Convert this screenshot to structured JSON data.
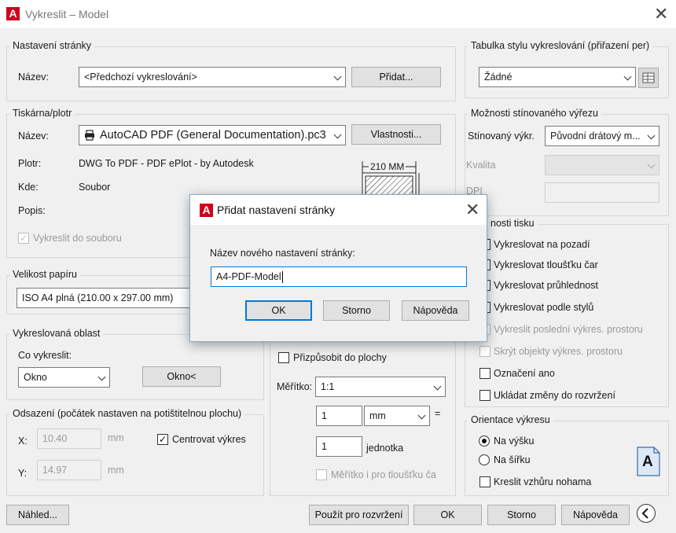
{
  "window": {
    "title": "Vykreslit – Model",
    "close": "✕"
  },
  "page_setup": {
    "group_title": "Nastavení stránky",
    "name_label": "Název:",
    "name_value": "<Předchozí vykreslování>",
    "add_button": "Přidat..."
  },
  "printer": {
    "group_title": "Tiskárna/plotr",
    "name_label": "Název:",
    "name_value": "AutoCAD PDF (General Documentation).pc3",
    "properties_button": "Vlastnosti...",
    "plotter_label": "Plotr:",
    "plotter_value": "DWG To PDF - PDF ePlot - by Autodesk",
    "where_label": "Kde:",
    "where_value": "Soubor",
    "desc_label": "Popis:",
    "plot_to_file_label": "Vykreslit do souboru",
    "preview_width": "210 MM"
  },
  "paper_size": {
    "group_title": "Velikost papíru",
    "value": "ISO A4 plná (210.00 x 297.00 mm)"
  },
  "plot_area": {
    "group_title": "Vykreslovaná oblast",
    "what_label": "Co vykreslit:",
    "what_value": "Okno",
    "window_button": "Okno<"
  },
  "plot_offset": {
    "group_title": "Odsazení (počátek nastaven na potištitelnou plochu)",
    "x_label": "X:",
    "x_value": "10.40",
    "x_unit": "mm",
    "y_label": "Y:",
    "y_value": "14.97",
    "y_unit": "mm",
    "center_label": "Centrovat výkres"
  },
  "plot_scale": {
    "fit_label": "Přizpůsobit do plochy",
    "scale_label": "Měřítko:",
    "scale_value": "1:1",
    "value1": "1",
    "unit1": "mm",
    "equals": "=",
    "value2": "1",
    "unit2": "jednotka",
    "lineweights_label": "Měřítko i pro tloušťku ča"
  },
  "plot_style_table": {
    "group_title": "Tabulka stylu vykreslování (přiřazení per)",
    "value": "Žádné"
  },
  "shaded": {
    "group_title": "Možnosti stínovaného výřezu",
    "shade_label": "Stínovaný výkr.",
    "shade_value": "Původní drátový m...",
    "quality_label": "Kvalita",
    "dpi_label": "DPI"
  },
  "plot_options": {
    "group_title": "nosti tisku",
    "items": [
      "Vykreslovat na pozadí",
      "Vykreslovat tloušťku čar",
      "Vykreslovat průhlednost",
      "Vykreslovat podle stylů",
      "Vykreslit poslední výkres. prostoru",
      "Skrýt objekty výkres. prostoru",
      "Označení ano",
      "Ukládat změny do rozvržení"
    ]
  },
  "orientation": {
    "group_title": "Orientace výkresu",
    "portrait": "Na výšku",
    "landscape": "Na šířku",
    "upside_down": "Kreslit vzhůru nohama",
    "icon_letter": "A"
  },
  "footer": {
    "preview_button": "Náhled...",
    "apply_button": "Použít pro rozvržení",
    "ok_button": "OK",
    "cancel_button": "Storno",
    "help_button": "Nápověda"
  },
  "add_dialog": {
    "title": "Přidat nastavení stránky",
    "close": "✕",
    "field_label": "Název nového nastavení stránky:",
    "field_value": "A4-PDF-Model",
    "ok_button": "OK",
    "cancel_button": "Storno",
    "help_button": "Nápověda"
  }
}
